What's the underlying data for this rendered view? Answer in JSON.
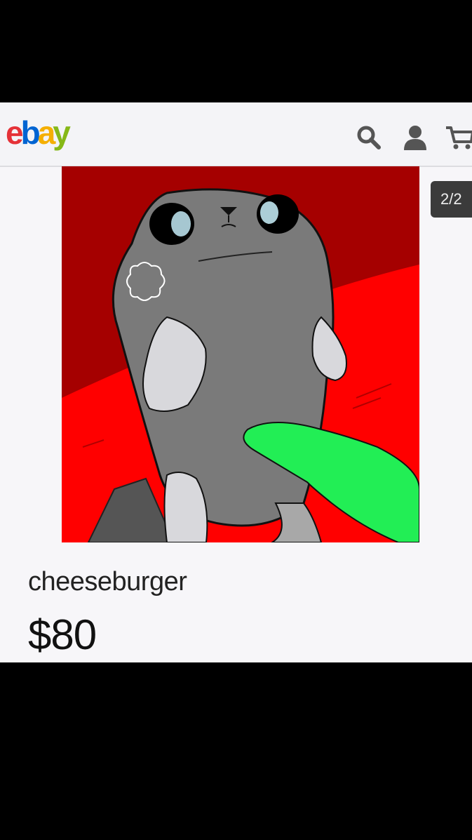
{
  "header": {
    "logo_letters": [
      "e",
      "b",
      "a",
      "y"
    ],
    "logo_colors": [
      "#e53238",
      "#0064d2",
      "#f5af02",
      "#86b817"
    ],
    "icons": [
      "search-icon",
      "user-icon",
      "cart-icon"
    ]
  },
  "gallery": {
    "counter": "2/2",
    "image_description_colors": {
      "background_dark": "#a50000",
      "background_bright": "#ff0000",
      "creature_body": "#7a7a7a",
      "finger": "#22ee55"
    }
  },
  "listing": {
    "title": "cheeseburger",
    "price": "$80"
  }
}
